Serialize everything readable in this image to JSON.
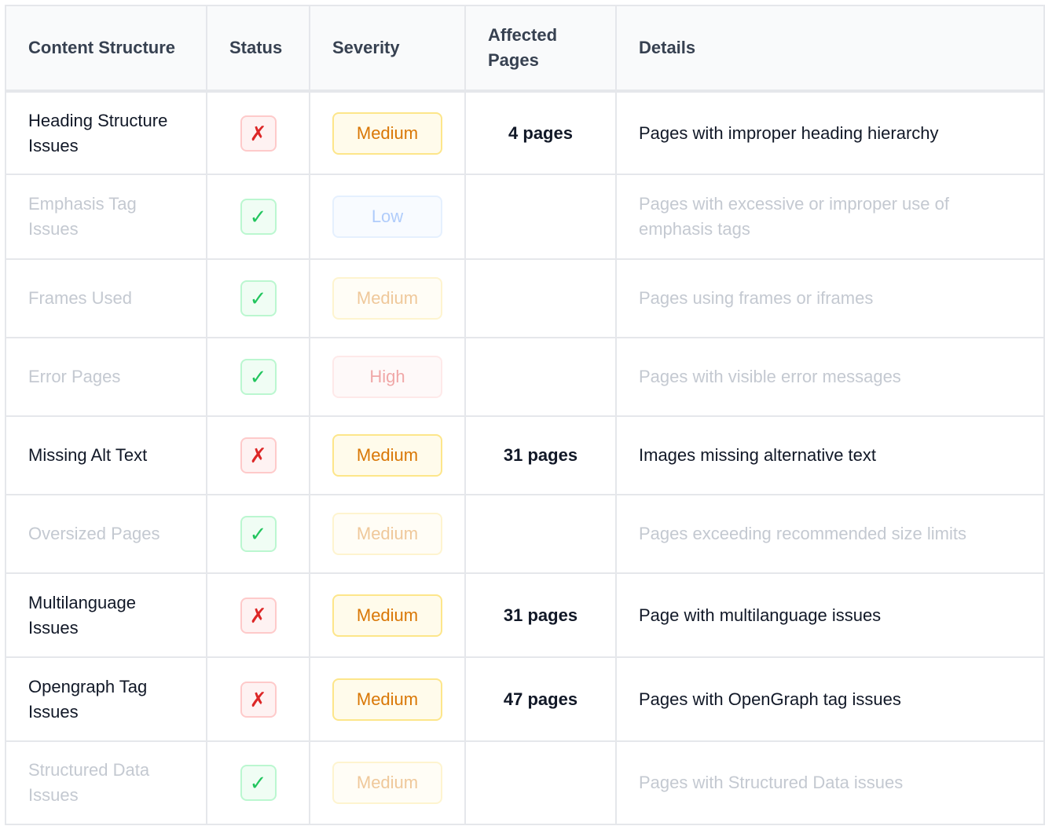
{
  "header": {
    "col_structure": "Content Structure",
    "col_status": "Status",
    "col_severity": "Severity",
    "col_affected": "Affected Pages",
    "col_details": "Details"
  },
  "rows": [
    {
      "name": "Heading Structure Issues",
      "status": "fail",
      "status_icon": "✗",
      "severity": "Medium",
      "affected": "4 pages",
      "details": "Pages with improper heading hierarchy"
    },
    {
      "name": "Emphasis Tag Issues",
      "status": "pass",
      "status_icon": "✓",
      "severity": "Low",
      "affected": "",
      "details": "Pages with excessive or improper use of emphasis tags"
    },
    {
      "name": "Frames Used",
      "status": "pass",
      "status_icon": "✓",
      "severity": "Medium",
      "affected": "",
      "details": "Pages using frames or iframes"
    },
    {
      "name": "Error Pages",
      "status": "pass",
      "status_icon": "✓",
      "severity": "High",
      "affected": "",
      "details": "Pages with visible error messages"
    },
    {
      "name": "Missing Alt Text",
      "status": "fail",
      "status_icon": "✗",
      "severity": "Medium",
      "affected": "31 pages",
      "details": "Images missing alternative text"
    },
    {
      "name": "Oversized Pages",
      "status": "pass",
      "status_icon": "✓",
      "severity": "Medium",
      "affected": "",
      "details": "Pages exceeding recommended size limits"
    },
    {
      "name": "Multilanguage Issues",
      "status": "fail",
      "status_icon": "✗",
      "severity": "Medium",
      "affected": "31 pages",
      "details": "Page with multilanguage issues"
    },
    {
      "name": "Opengraph Tag Issues",
      "status": "fail",
      "status_icon": "✗",
      "severity": "Medium",
      "affected": "47 pages",
      "details": "Pages with OpenGraph tag issues"
    },
    {
      "name": "Structured Data Issues",
      "status": "pass",
      "status_icon": "✓",
      "severity": "Medium",
      "affected": "",
      "details": "Pages with Structured Data issues"
    }
  ]
}
